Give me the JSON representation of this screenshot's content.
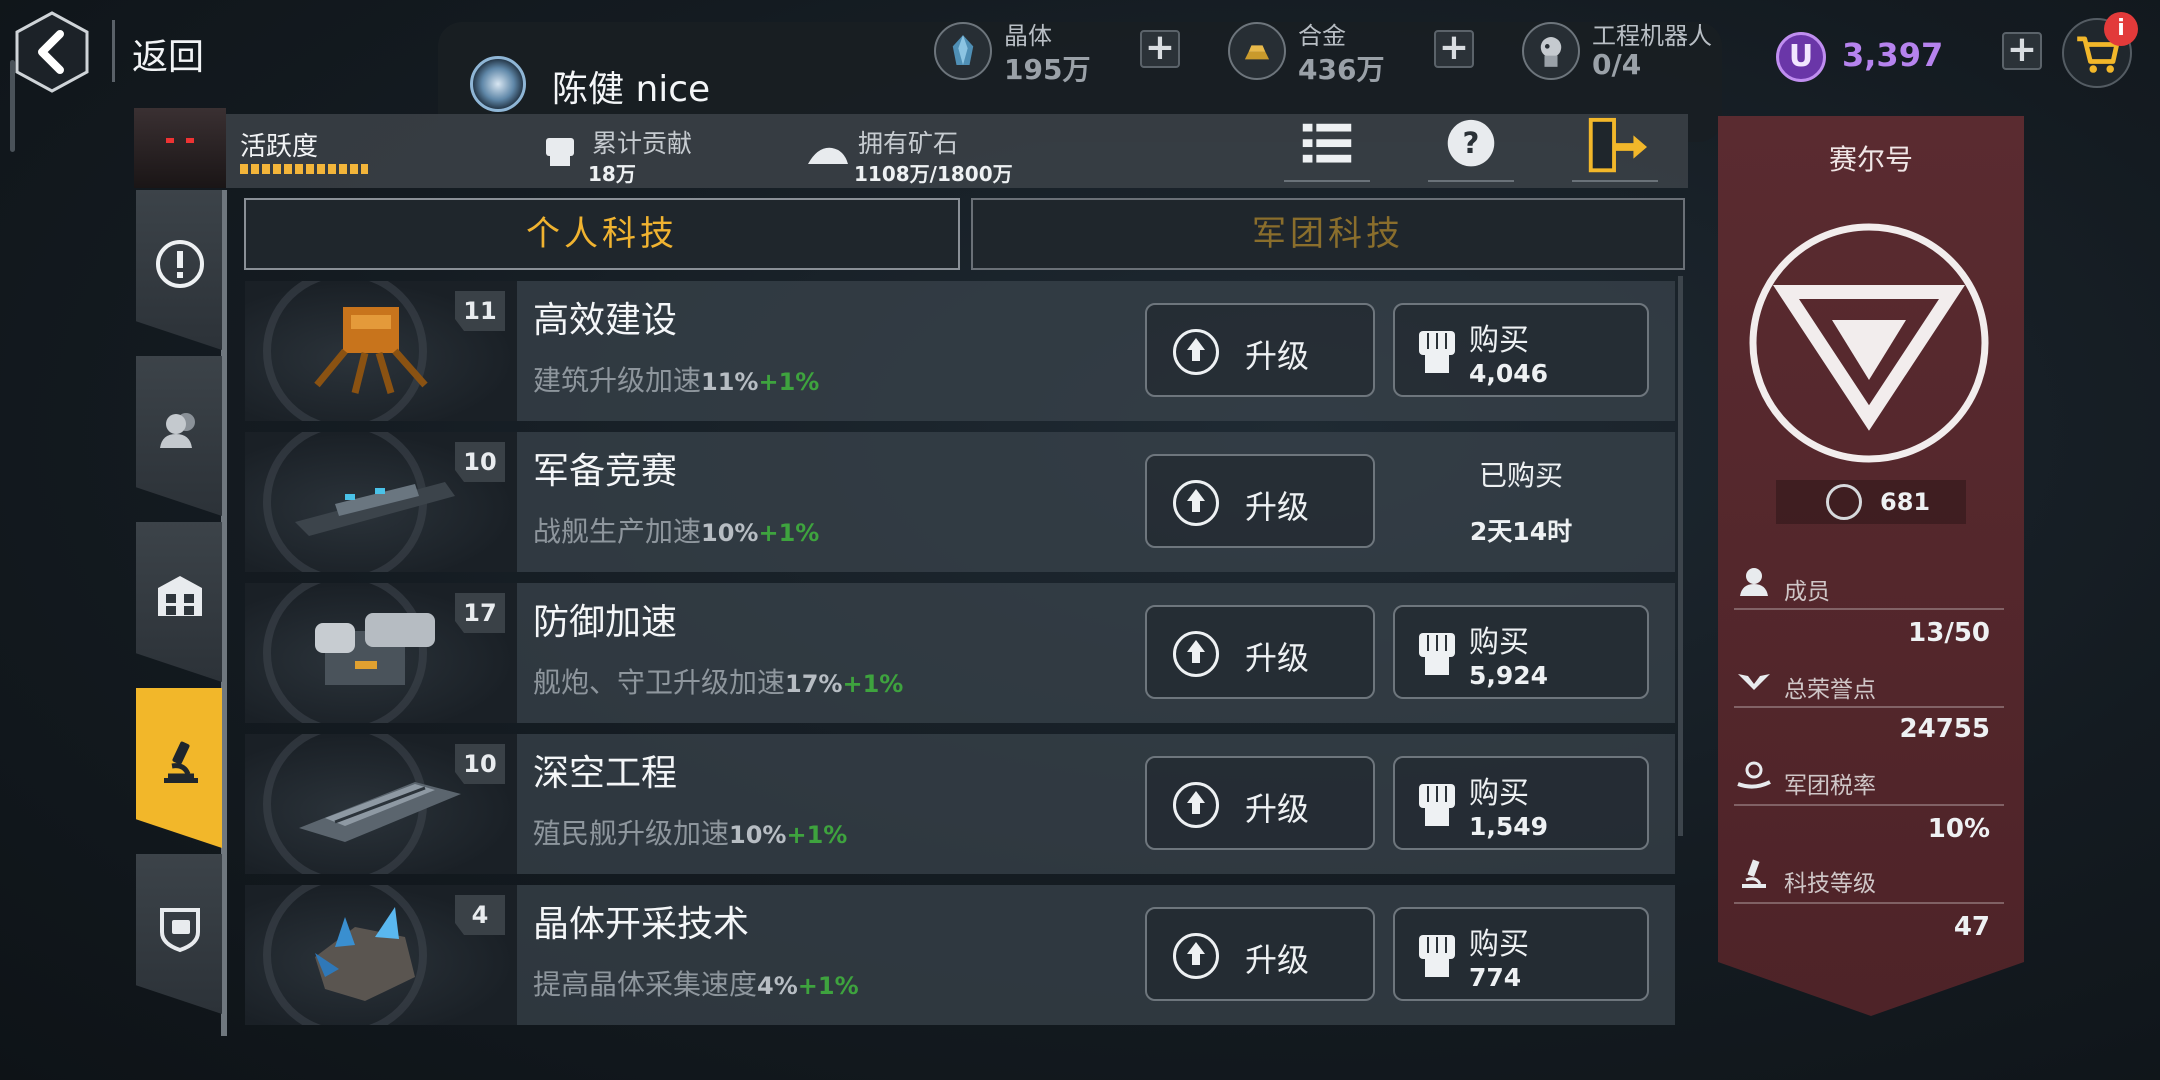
{
  "header": {
    "back_label": "返回",
    "notice_text": "陈健  nice"
  },
  "resources": [
    {
      "name": "晶体",
      "value": "195万",
      "icon": "crystal-icon"
    },
    {
      "name": "合金",
      "value": "436万",
      "icon": "alloy-icon"
    },
    {
      "name": "工程机器人",
      "value": "0/4",
      "icon": "robot-icon"
    }
  ],
  "currency": {
    "symbol": "U",
    "value": "3,397",
    "color": "#b683ee"
  },
  "cart": {
    "badge": "i"
  },
  "profile": {
    "activity_label": "活跃度",
    "contribution_label": "累计贡献",
    "contribution_value": "18万",
    "ore_label": "拥有矿石",
    "ore_value": "1108万/1800万"
  },
  "tabs": [
    {
      "label": "个人科技",
      "active": true
    },
    {
      "label": "军团科技",
      "active": false
    }
  ],
  "side_tabs": [
    "alert-icon",
    "members-icon",
    "building-icon",
    "microscope-icon",
    "emblem-icon"
  ],
  "techs": [
    {
      "level": "11",
      "title": "高效建设",
      "desc": "建筑升级加速",
      "pct": "11%",
      "plus": "+1%",
      "upgrade": "升级",
      "buy": "购买",
      "price": "4,046",
      "bought": false
    },
    {
      "level": "10",
      "title": "军备竞赛",
      "desc": "战舰生产加速",
      "pct": "10%",
      "plus": "+1%",
      "upgrade": "升级",
      "bought": true,
      "bought_label": "已购买",
      "timer": "2天14时"
    },
    {
      "level": "17",
      "title": "防御加速",
      "desc": "舰炮、守卫升级加速",
      "pct": "17%",
      "plus": "+1%",
      "upgrade": "升级",
      "buy": "购买",
      "price": "5,924",
      "bought": false
    },
    {
      "level": "10",
      "title": "深空工程",
      "desc": "殖民舰升级加速",
      "pct": "10%",
      "plus": "+1%",
      "upgrade": "升级",
      "buy": "购买",
      "price": "1,549",
      "bought": false
    },
    {
      "level": "4",
      "title": "晶体开采技术",
      "desc": "提高晶体采集速度",
      "pct": "4%",
      "plus": "+1%",
      "upgrade": "升级",
      "buy": "购买",
      "price": "774",
      "bought": false
    }
  ],
  "guild": {
    "name": "赛尔号",
    "reputation": "681",
    "stats": [
      {
        "label": "成员",
        "value": "13/50",
        "icon": "member-icon"
      },
      {
        "label": "总荣誉点",
        "value": "24755",
        "icon": "wings-icon"
      },
      {
        "label": "军团税率",
        "value": "10%",
        "icon": "tax-icon"
      },
      {
        "label": "科技等级",
        "value": "47",
        "icon": "microscope-icon"
      }
    ]
  }
}
